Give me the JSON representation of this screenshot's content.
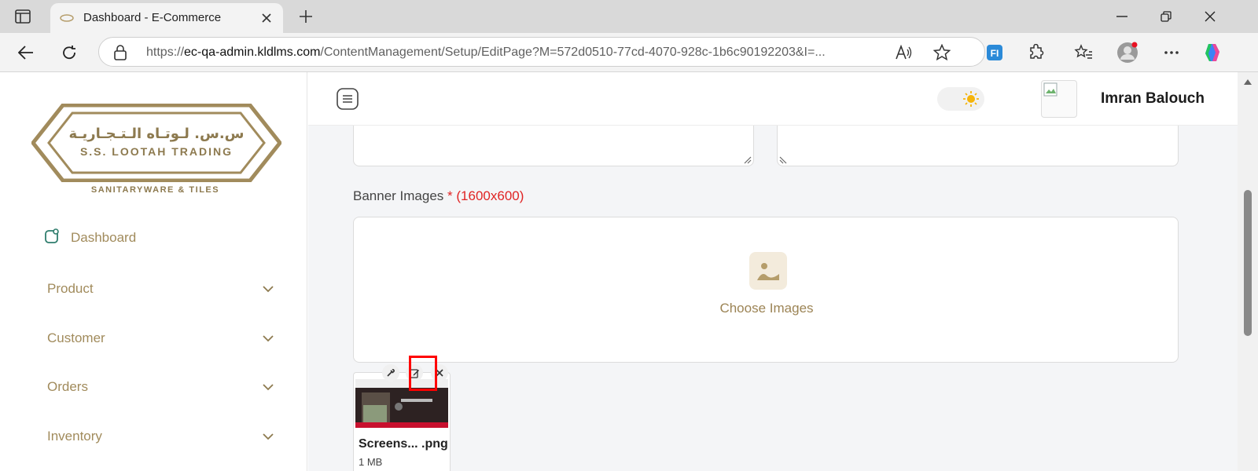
{
  "browser": {
    "tab_title": "Dashboard - E-Commerce",
    "url_prefix": "https://",
    "url_host": "ec-qa-admin.kldlms.com",
    "url_path": "/ContentManagement/Setup/EditPage?M=572d0510-77cd-4070-928c-1b6c90192203&I=..."
  },
  "brand": {
    "logo_arabic": "س.س. لـوتـاه الـتـجـاريـة",
    "logo_english": "S.S. LOOTAH TRADING",
    "logo_subtitle": "SANITARYWARE & TILES",
    "accent": "#a18b5c",
    "required": "#e02424"
  },
  "sidebar": {
    "dashboard_label": "Dashboard",
    "items": [
      {
        "label": "Product"
      },
      {
        "label": "Customer"
      },
      {
        "label": "Orders"
      },
      {
        "label": "Inventory"
      }
    ]
  },
  "header": {
    "username": "Imran Balouch"
  },
  "form": {
    "banner_label": "Banner Images",
    "required_mark": "*",
    "banner_hint": "(1600x600)",
    "choose_label": "Choose Images"
  },
  "thumbnail": {
    "file_name": "Screens... .png",
    "file_size": "1 MB"
  }
}
